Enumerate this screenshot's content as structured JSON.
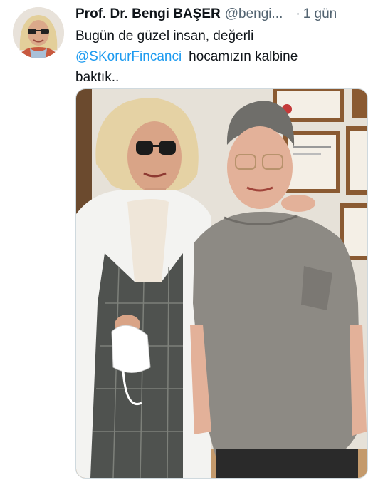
{
  "author": {
    "name": "Prof. Dr. Bengi BAŞER",
    "handle": "@bengi...",
    "separator": "·",
    "timestamp": "1 gün"
  },
  "tweet": {
    "line1": "Bugün de güzel insan, değerli",
    "mention": "@SKorurFincanci",
    "line2_rest": "hocamızın kalbine",
    "line3": "baktık.."
  },
  "colors": {
    "mention": "#1d9bf0",
    "secondary_text": "#536471",
    "primary_text": "#0f1419"
  },
  "icons": {
    "avatar": "profile-photo",
    "media": "tweet-photo"
  }
}
